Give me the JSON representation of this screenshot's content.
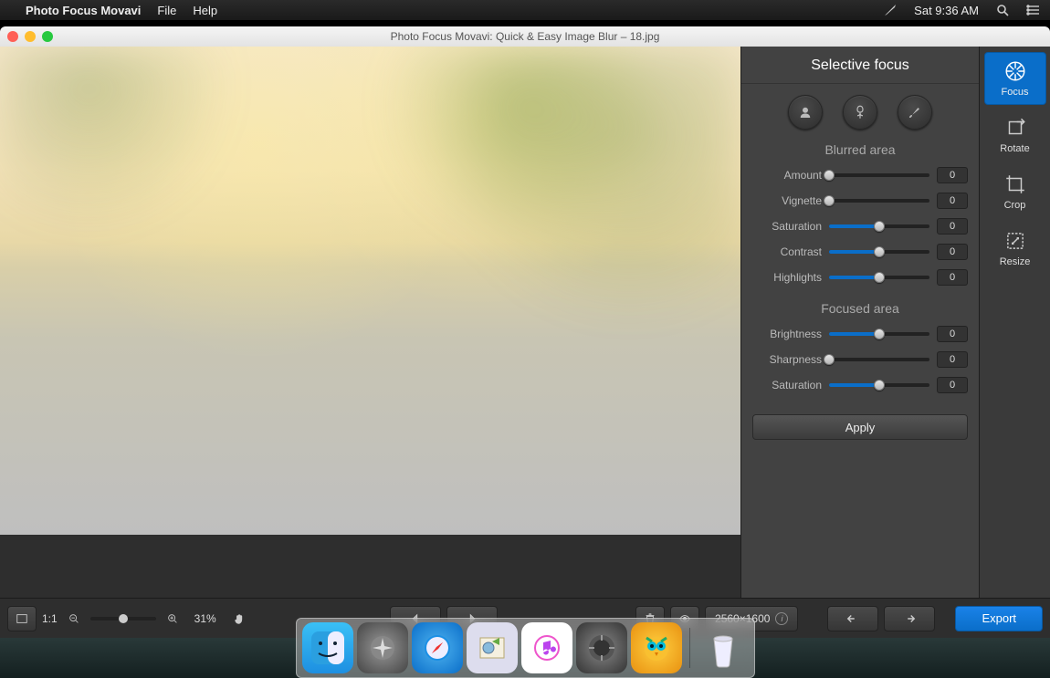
{
  "menubar": {
    "app": "Photo Focus Movavi",
    "items": [
      "File",
      "Help"
    ],
    "clock": "Sat 9:36 AM"
  },
  "window": {
    "title": "Photo Focus Movavi: Quick & Easy Image Blur – 18.jpg"
  },
  "rail": {
    "tabs": [
      {
        "id": "focus",
        "label": "Focus",
        "active": true
      },
      {
        "id": "rotate",
        "label": "Rotate",
        "active": false
      },
      {
        "id": "crop",
        "label": "Crop",
        "active": false
      },
      {
        "id": "resize",
        "label": "Resize",
        "active": false
      }
    ]
  },
  "panel": {
    "title": "Selective focus",
    "blurred_label": "Blurred area",
    "focused_label": "Focused area",
    "blurred": [
      {
        "id": "amount",
        "label": "Amount",
        "value": 0,
        "fillPct": 0,
        "thumbPct": 0
      },
      {
        "id": "vignette",
        "label": "Vignette",
        "value": 0,
        "fillPct": 0,
        "thumbPct": 0
      },
      {
        "id": "saturation",
        "label": "Saturation",
        "value": 0,
        "fillPct": 50,
        "thumbPct": 50
      },
      {
        "id": "contrast",
        "label": "Contrast",
        "value": 0,
        "fillPct": 50,
        "thumbPct": 50
      },
      {
        "id": "highlights",
        "label": "Highlights",
        "value": 0,
        "fillPct": 50,
        "thumbPct": 50
      }
    ],
    "focused": [
      {
        "id": "brightness",
        "label": "Brightness",
        "value": 0,
        "fillPct": 50,
        "thumbPct": 50
      },
      {
        "id": "sharpness",
        "label": "Sharpness",
        "value": 0,
        "fillPct": 0,
        "thumbPct": 0
      },
      {
        "id": "saturation2",
        "label": "Saturation",
        "value": 0,
        "fillPct": 50,
        "thumbPct": 50
      }
    ],
    "apply": "Apply"
  },
  "bottom": {
    "one_to_one": "1:1",
    "zoom_pct": "31%",
    "dimensions": "2560×1600",
    "export": "Export"
  },
  "dock": {
    "apps": [
      "finder",
      "launchpad",
      "safari",
      "mail",
      "itunes",
      "settings",
      "owl"
    ],
    "trash": "trash"
  }
}
